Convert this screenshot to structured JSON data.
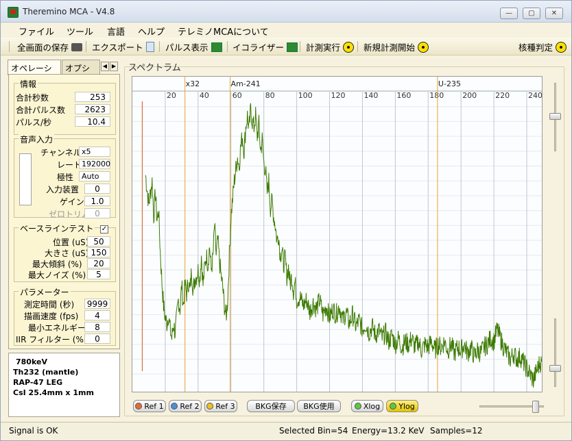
{
  "window": {
    "title": "Theremino MCA - V4.8",
    "buttons": {
      "minimize": "—",
      "maximize": "▢",
      "close": "✕"
    }
  },
  "menu": {
    "items": [
      "ファイル",
      "ツール",
      "言語",
      "ヘルプ",
      "テレミノMCAについて"
    ]
  },
  "toolbar": {
    "save_screen": "全画面の保存",
    "export": "エクスポート",
    "pulse_display": "パルス表示",
    "equalizer": "イコライザー",
    "run": "計測実行",
    "new_run": "新規計測開始",
    "nuclide": "核種判定"
  },
  "tabs": {
    "operation": "オペレーション",
    "options": "オプション",
    "scroll_left": "◀",
    "scroll_right": "▶"
  },
  "info": {
    "title": "情報",
    "total_seconds_label": "合計秒数",
    "total_seconds": "253",
    "total_pulses_label": "合計パルス数",
    "total_pulses": "2623",
    "pulses_per_sec_label": "パルス/秒",
    "pulses_per_sec": "10.4"
  },
  "audio": {
    "title": "音声入力",
    "channel_label": "チャンネル",
    "channel": "x5",
    "rate_label": "レート",
    "rate": "192000",
    "polarity_label": "極性",
    "polarity": "Auto",
    "device_label": "入力装置",
    "device": "0",
    "gain_label": "ゲイン",
    "gain": "1.0",
    "zero_trim_label": "ゼロトリム",
    "zero_trim": "0"
  },
  "baseline": {
    "title": "ベースラインテスト",
    "checked": "✓",
    "position_label": "位置 (uS)",
    "position": "50",
    "size_label": "大きさ (uS)",
    "size": "150",
    "max_slope_label": "最大傾斜 (%)",
    "max_slope": "20",
    "max_noise_label": "最大ノイズ (%)",
    "max_noise": "5"
  },
  "params": {
    "title": "パラメーター",
    "measure_time_label": "測定時間 (秒)",
    "measure_time": "9999",
    "draw_speed_label": "描画速度 (fps)",
    "draw_speed": "4",
    "min_energy_label": "最小エネルギー",
    "min_energy": "8",
    "iir_label": "IIR フィルター (%)",
    "iir": "0"
  },
  "notes": [
    "780keV",
    "Th232 (mantle)",
    "RAP-47 LEG",
    "CsI 25.4mm x 1mm"
  ],
  "spectrum": {
    "title": "スペクトラム",
    "markers": [
      {
        "label": "x32",
        "x": 32
      },
      {
        "label": "Am-241",
        "x": 59.5
      },
      {
        "label": "U-235",
        "x": 185.7
      }
    ],
    "ref_line_x": 6,
    "x_ticks": [
      "20",
      "40",
      "60",
      "80",
      "100",
      "120",
      "140",
      "160",
      "180",
      "200",
      "220",
      "240"
    ],
    "plot_color": "#3c7a00",
    "marker_color": "#f0a030",
    "ref_color": "#d45010"
  },
  "chart_data": {
    "type": "line",
    "xlim": [
      0,
      250
    ],
    "ylim": [
      0,
      100
    ],
    "grid": true,
    "series": [
      {
        "points": [
          [
            8,
            72
          ],
          [
            10,
            62
          ],
          [
            12,
            70
          ],
          [
            13,
            58
          ],
          [
            14,
            66
          ],
          [
            15,
            57
          ],
          [
            16,
            60
          ],
          [
            17,
            46
          ],
          [
            18,
            36
          ],
          [
            19,
            28
          ],
          [
            20,
            24
          ],
          [
            21,
            22
          ],
          [
            22,
            25
          ],
          [
            23,
            20
          ],
          [
            24,
            17
          ],
          [
            25,
            22
          ],
          [
            26,
            19
          ],
          [
            27,
            24
          ],
          [
            28,
            30
          ],
          [
            29,
            27
          ],
          [
            30,
            35
          ],
          [
            31,
            28
          ],
          [
            32,
            35
          ],
          [
            33,
            32
          ],
          [
            34,
            36
          ],
          [
            35,
            33
          ],
          [
            36,
            40
          ],
          [
            37,
            33
          ],
          [
            38,
            37
          ],
          [
            39,
            38
          ],
          [
            40,
            40
          ],
          [
            41,
            37
          ],
          [
            42,
            45
          ],
          [
            43,
            35
          ],
          [
            44,
            41
          ],
          [
            45,
            45
          ],
          [
            46,
            42
          ],
          [
            47,
            48
          ],
          [
            48,
            40
          ],
          [
            49,
            44
          ],
          [
            50,
            55
          ],
          [
            51,
            45
          ],
          [
            52,
            50
          ],
          [
            53,
            43
          ],
          [
            54,
            38
          ],
          [
            55,
            34
          ],
          [
            56,
            28
          ],
          [
            57,
            24
          ],
          [
            58,
            30
          ],
          [
            59,
            45
          ],
          [
            60,
            58
          ],
          [
            61,
            64
          ],
          [
            62,
            70
          ],
          [
            63,
            74
          ],
          [
            64,
            78
          ],
          [
            65,
            75
          ],
          [
            66,
            82
          ],
          [
            67,
            85
          ],
          [
            68,
            80
          ],
          [
            69,
            88
          ],
          [
            70,
            92
          ],
          [
            71,
            87
          ],
          [
            72,
            94
          ],
          [
            73,
            90
          ],
          [
            74,
            88
          ],
          [
            75,
            92
          ],
          [
            76,
            85
          ],
          [
            77,
            89
          ],
          [
            78,
            80
          ],
          [
            79,
            84
          ],
          [
            80,
            76
          ],
          [
            81,
            74
          ],
          [
            82,
            66
          ],
          [
            83,
            70
          ],
          [
            84,
            61
          ],
          [
            85,
            63
          ],
          [
            86,
            58
          ],
          [
            87,
            55
          ],
          [
            88,
            50
          ],
          [
            89,
            52
          ],
          [
            90,
            45
          ],
          [
            91,
            47
          ],
          [
            92,
            42
          ],
          [
            93,
            44
          ],
          [
            94,
            38
          ],
          [
            95,
            41
          ],
          [
            96,
            35
          ],
          [
            97,
            38
          ],
          [
            98,
            33
          ],
          [
            99,
            36
          ],
          [
            100,
            30
          ],
          [
            102,
            31
          ],
          [
            104,
            28
          ],
          [
            106,
            30
          ],
          [
            108,
            26
          ],
          [
            110,
            29
          ],
          [
            112,
            27
          ],
          [
            114,
            30
          ],
          [
            116,
            25
          ],
          [
            118,
            28
          ],
          [
            120,
            24
          ],
          [
            122,
            27
          ],
          [
            124,
            25
          ],
          [
            126,
            28
          ],
          [
            128,
            23
          ],
          [
            130,
            26
          ],
          [
            132,
            22
          ],
          [
            134,
            25
          ],
          [
            136,
            21
          ],
          [
            138,
            23
          ],
          [
            140,
            20
          ],
          [
            142,
            22
          ],
          [
            144,
            19
          ],
          [
            146,
            21
          ],
          [
            148,
            18
          ],
          [
            150,
            20
          ],
          [
            152,
            17
          ],
          [
            154,
            19
          ],
          [
            156,
            16
          ],
          [
            158,
            18
          ],
          [
            160,
            15
          ],
          [
            162,
            17
          ],
          [
            164,
            14
          ],
          [
            166,
            16
          ],
          [
            168,
            15
          ],
          [
            170,
            17
          ],
          [
            172,
            14
          ],
          [
            174,
            16
          ],
          [
            176,
            13
          ],
          [
            178,
            15
          ],
          [
            180,
            14
          ],
          [
            182,
            16
          ],
          [
            184,
            13
          ],
          [
            186,
            15
          ],
          [
            188,
            14
          ],
          [
            190,
            16
          ],
          [
            192,
            13
          ],
          [
            194,
            15
          ],
          [
            196,
            12
          ],
          [
            198,
            14
          ],
          [
            200,
            13
          ],
          [
            202,
            15
          ],
          [
            204,
            12
          ],
          [
            206,
            14
          ],
          [
            208,
            11
          ],
          [
            210,
            13
          ],
          [
            212,
            12
          ],
          [
            214,
            14
          ],
          [
            216,
            15
          ],
          [
            218,
            17
          ],
          [
            220,
            16
          ],
          [
            222,
            20
          ],
          [
            224,
            17
          ],
          [
            226,
            14
          ],
          [
            228,
            12
          ],
          [
            230,
            10
          ],
          [
            232,
            12
          ],
          [
            234,
            10
          ],
          [
            236,
            11
          ],
          [
            238,
            9
          ],
          [
            240,
            7
          ],
          [
            242,
            5
          ],
          [
            244,
            3
          ],
          [
            246,
            6
          ],
          [
            248,
            9
          ],
          [
            250,
            8
          ]
        ]
      }
    ]
  },
  "buttons": {
    "ref1": "Ref 1",
    "ref2": "Ref 2",
    "ref3": "Ref 3",
    "bkg_save": "BKG保存",
    "bkg_use": "BKG使用",
    "xlog": "Xlog",
    "ylog": "Ylog"
  },
  "status": {
    "signal": "Signal is OK",
    "selected_bin": "Selected Bin=54",
    "energy": "Energy=13.2 KeV",
    "samples": "Samples=12"
  }
}
